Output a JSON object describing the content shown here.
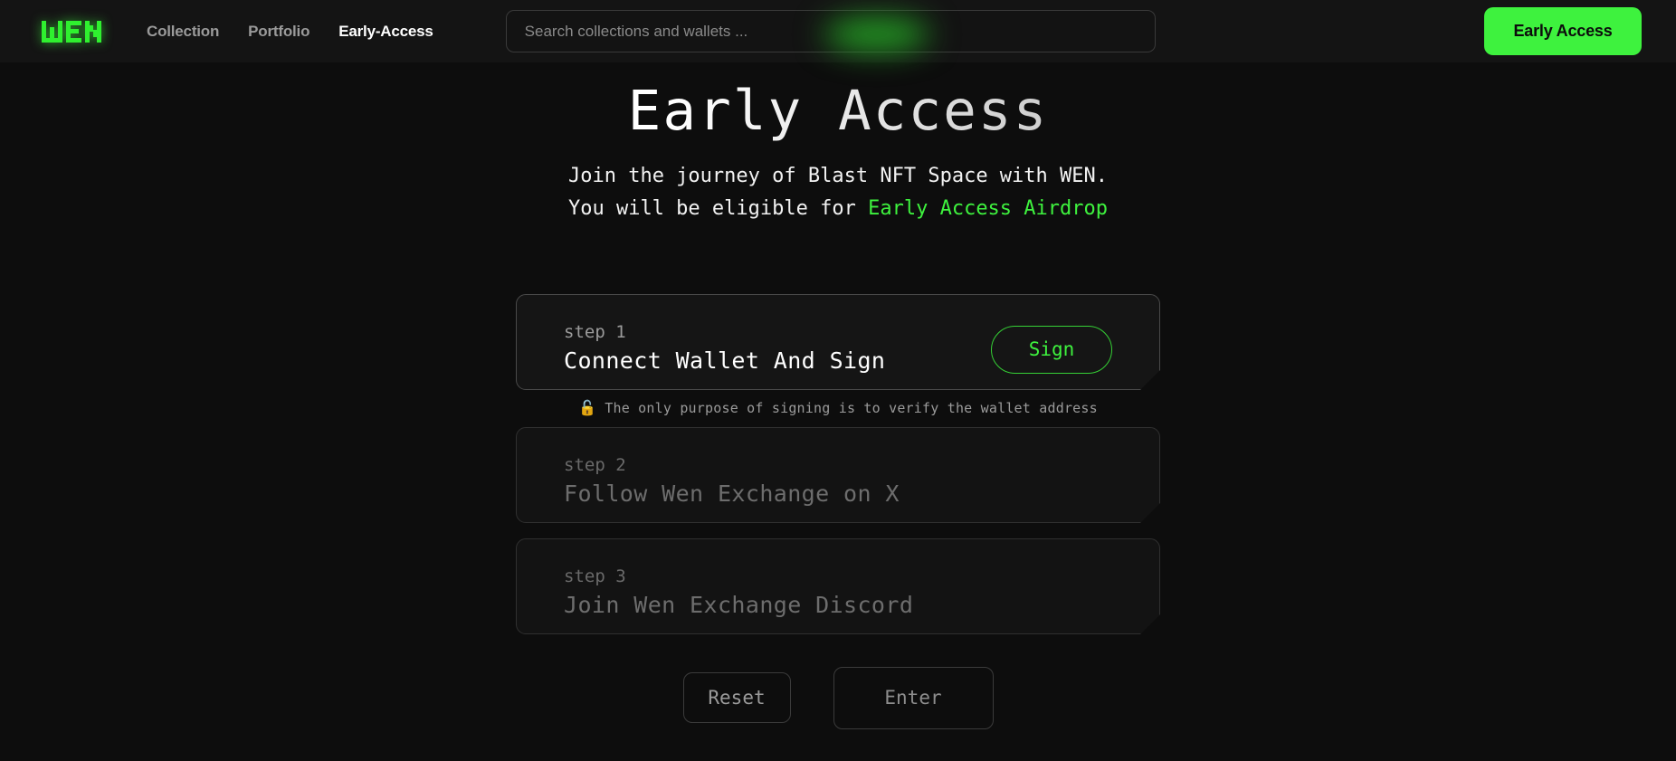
{
  "header": {
    "logo_text": "WEN",
    "logo_icon": "wen-wordmark-icon",
    "nav": [
      {
        "label": "Collection",
        "active": false
      },
      {
        "label": "Portfolio",
        "active": false
      },
      {
        "label": "Early-Access",
        "active": true
      }
    ],
    "search": {
      "placeholder": "Search collections and wallets ...",
      "value": ""
    },
    "cta_label": "Early Access",
    "accent_color": "#3ef23e"
  },
  "hero": {
    "title": "Early Access",
    "subtitle_line1": "Join the journey of Blast NFT Space with WEN.",
    "subtitle_line2_prefix": "You will be eligible for ",
    "subtitle_line2_accent": "Early Access Airdrop"
  },
  "steps": [
    {
      "label": "step 1",
      "title": "Connect Wallet And Sign",
      "button_label": "Sign",
      "state": "active"
    },
    {
      "label": "step 2",
      "title": "Follow Wen Exchange on X",
      "button_label": "",
      "state": "disabled"
    },
    {
      "label": "step 3",
      "title": "Join Wen Exchange Discord",
      "button_label": "",
      "state": "disabled"
    }
  ],
  "step_note": {
    "icon": "open-padlock-icon",
    "icon_glyph": "🔓",
    "text": "The only purpose of signing is to verify the wallet address"
  },
  "actions": {
    "reset_label": "Reset",
    "enter_label": "Enter"
  },
  "colors": {
    "page_background": "#0d0d0d",
    "header_background": "#141414",
    "accent_green": "#3ef23e",
    "muted_text": "#9a9a9a",
    "card_background": "#151515",
    "card_border": "#4a4a4a"
  }
}
